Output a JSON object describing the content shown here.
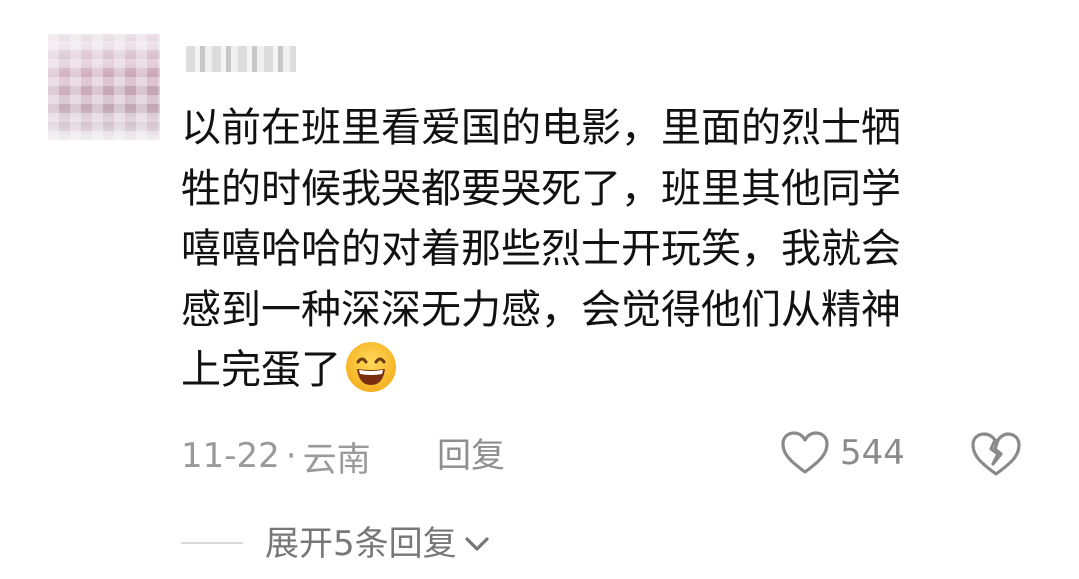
{
  "comment": {
    "lines": [
      "以前在班里看爱国的电影，里面的烈士牺",
      "牲的时候我哭都要哭死了，班里其他同学",
      "嘻嘻哈哈的对着那些烈士开玩笑，我就会",
      "感到一种深深无力感，会觉得他们从精神",
      "上完蛋了"
    ],
    "emoji": "grinning-face-with-smiling-eyes"
  },
  "meta": {
    "date": "11-22",
    "separator": "·",
    "location": "云南",
    "reply_label": "回复"
  },
  "likes": {
    "count": "544"
  },
  "replies": {
    "expand_label": "展开5条回复"
  },
  "colors": {
    "text": "#111111",
    "muted": "#9a9a9a",
    "icon": "#8a8a8a",
    "emoji_face": "#f6c33b"
  }
}
